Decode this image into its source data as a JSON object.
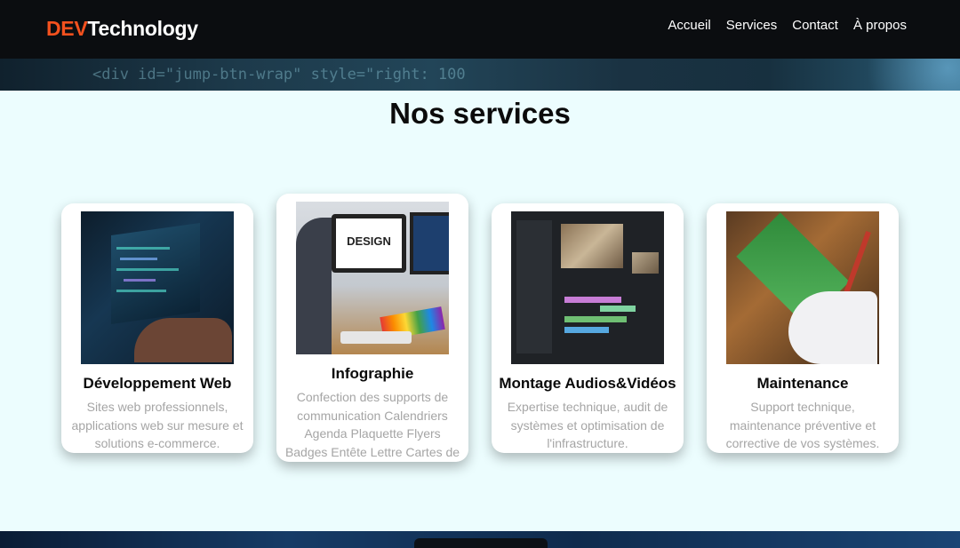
{
  "header": {
    "logo_accent": "DEV",
    "logo_main": "Technology",
    "nav": [
      {
        "label": "Accueil"
      },
      {
        "label": "Services"
      },
      {
        "label": "Contact"
      },
      {
        "label": "À propos"
      }
    ]
  },
  "hero": {
    "code_snippet": "<div id=\"jump-btn-wrap\" style=\"right: 100"
  },
  "services": {
    "title": "Nos services",
    "cards": [
      {
        "title": "Développement Web",
        "description": "Sites web professionnels, applications web sur mesure et solutions e-commerce.",
        "image": "developer-laptop-image"
      },
      {
        "title": "Infographie",
        "description": "Confection des supports de communication Calendriers Agenda Plaquette Flyers Badges Entête Lettre Cartes de Visite",
        "image": "design-workspace-image",
        "image_text": "DESIGN"
      },
      {
        "title": "Montage Audios&Vidéos",
        "description": "Expertise technique, audit de systèmes et optimisation de l'infrastructure.",
        "image": "video-editing-image"
      },
      {
        "title": "Maintenance",
        "description": "Support technique, maintenance préventive et corrective de vos systèmes.",
        "image": "circuit-board-image"
      }
    ]
  },
  "colors": {
    "brand_accent": "#f4511e",
    "header_bg": "#0b0d10",
    "section_bg": "#ecfdfe",
    "muted_text": "#a5a5a5"
  }
}
